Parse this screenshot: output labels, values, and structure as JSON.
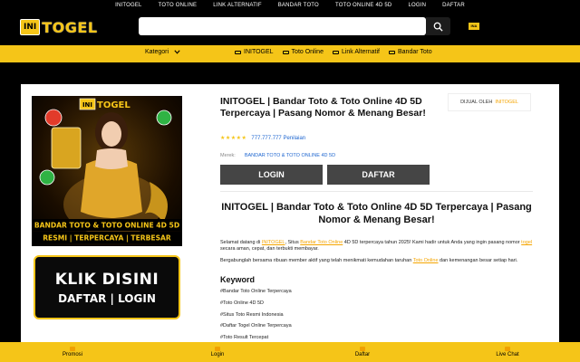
{
  "topnav": [
    "INITOGEL",
    "TOTO ONLINE",
    "LINK ALTERNATIF",
    "BANDAR TOTO",
    "TOTO ONLINE 4D 5D",
    "LOGIN",
    "DAFTAR"
  ],
  "header": {
    "logo_badge": "INI",
    "logo_word": "TOGEL",
    "search_placeholder": "",
    "flag_label": "INA"
  },
  "catbar": {
    "kategori": "Kategori",
    "links": [
      "INITOGEL",
      "Toto Online",
      "Link Alternatif",
      "Bandar Toto"
    ]
  },
  "product": {
    "img_top_badge": "INI",
    "img_top_word": "TOGEL",
    "img_ribbon_1": "BANDAR TOTO & TOTO ONLINE 4D 5D",
    "img_ribbon_2": "RESMI | TERPERCAYA | TERBESAR",
    "banner_l1": "KLIK DISINI",
    "banner_l2": "DAFTAR | LOGIN",
    "title": "INITOGEL | Bandar Toto & Toto Online 4D 5D Terpercaya | Pasang Nomor & Menang Besar!",
    "seller_label": "DIJUAL OLEH",
    "seller_name": "INITOGEL",
    "stars": "★★★★★",
    "rating_count": "777.777.777 Penilaian",
    "merek_label": "Merek:",
    "merek_value": "BANDAR TOTO & TOTO ONLINE 4D 5D",
    "login_label": "LOGIN",
    "daftar_label": "DAFTAR"
  },
  "article": {
    "heading": "INITOGEL | Bandar Toto & Toto Online 4D 5D Terpercaya | Pasang Nomor & Menang Besar!",
    "p1_a": "Selamat datang di ",
    "p1_link1": "INITOGEL",
    "p1_b": ", Situs ",
    "p1_link2": "Bandar Toto Online",
    "p1_c": " 4D 5D terpercaya tahun 2025! Kami hadir untuk Anda yang ingin pasang nomor ",
    "p1_link3": "togel",
    "p1_d": " secara aman, cepat, dan terbukti membayar.",
    "p2_a": "Bergabunglah bersama ribuan member aktif yang telah menikmati kemudahan taruhan ",
    "p2_link": "Toto Online",
    "p2_b": " dan kemenangan besar setiap hari.",
    "keyword_heading": "Keyword",
    "keywords": [
      "#Bandar Toto Online Terpercaya",
      "#Toto Online 4D 5D",
      "#Situs Toto Resmi Indonesia",
      "#Daftar Togel Online Terpercaya",
      "#Toto Result Tercepat"
    ]
  },
  "bottom": [
    "Promosi",
    "Login",
    "Daftar",
    "Live Chat"
  ]
}
